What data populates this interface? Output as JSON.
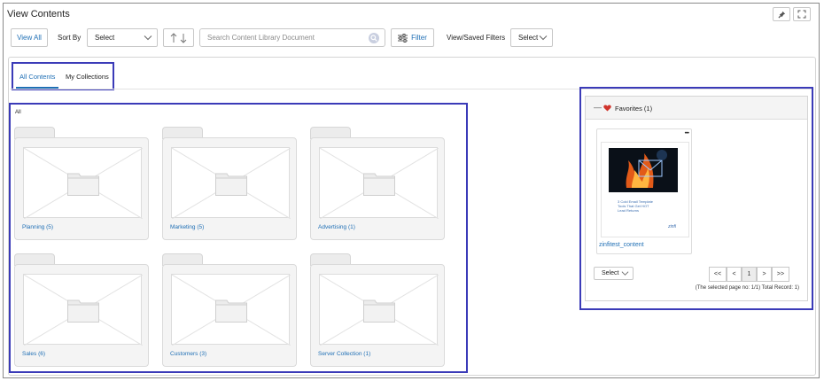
{
  "header": {
    "title": "View Contents"
  },
  "toolbar": {
    "view_all": "View All",
    "sort_by_label": "Sort By",
    "sort_select": "Select",
    "search_placeholder": "Search Content Library Document",
    "filter_label": "Filter",
    "saved_filters_label": "View/Saved Filters",
    "saved_filters_select": "Select"
  },
  "tabs": [
    {
      "label": "All Contents",
      "active": true
    },
    {
      "label": "My Collections",
      "active": false
    }
  ],
  "folders_section": {
    "heading": "All",
    "folders": [
      {
        "label": "Planning (5)"
      },
      {
        "label": "Marketing (5)"
      },
      {
        "label": "Advertising (1)"
      },
      {
        "label": "Sales (6)"
      },
      {
        "label": "Customers (3)"
      },
      {
        "label": "Server Collection (1)"
      }
    ]
  },
  "favorites": {
    "title": "Favorites (1)",
    "collapse_symbol": "—",
    "card": {
      "menu": "••••",
      "thumb_lines": [
        "3 Cold Email Template",
        "Tools That Get HOT",
        "Lead Returns"
      ],
      "thumb_brand": "zinfi",
      "name": "zinfitest_content"
    },
    "select_label": "Select",
    "pagination": {
      "first": "<<",
      "prev": "<",
      "page": "1",
      "next": ">",
      "last": ">>"
    },
    "record_info": "(The selected page no: 1/1) Total Record: 1)"
  },
  "colors": {
    "accent": "#1f6fb5",
    "highlight_border": "#3b3bb8",
    "heart": "#d0342c"
  },
  "icons": [
    "pin-icon",
    "expand-icon",
    "sort-up-icon",
    "sort-down-icon",
    "search-icon",
    "filter-sliders-icon",
    "chevron-down-icon",
    "heart-icon",
    "folder-icon"
  ]
}
